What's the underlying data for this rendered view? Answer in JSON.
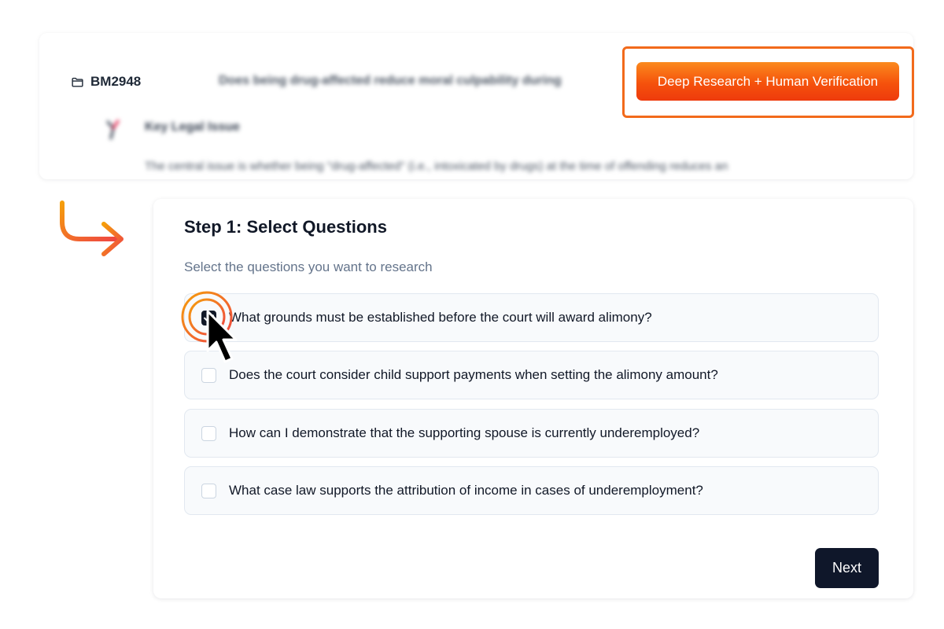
{
  "case": {
    "id": "BM2948",
    "question": "Does being drug-affected reduce moral culpability during",
    "issue_title": "Key Legal Issue",
    "issue_text": "The central issue is whether being \"drug-affected\" (i.e., intoxicated by drugs) at the time of offending reduces an"
  },
  "deep_research_button": "Deep Research + Human Verification",
  "step": {
    "title": "Step 1: Select Questions",
    "subtitle": "Select the questions you want to research",
    "questions": [
      {
        "label": "What grounds must be established before the court will award alimony?",
        "checked": true
      },
      {
        "label": "Does the court consider child support payments when setting the alimony amount?",
        "checked": false
      },
      {
        "label": "How can I demonstrate that the supporting spouse is currently underemployed?",
        "checked": false
      },
      {
        "label": "What case law supports the attribution of income in cases of underemployment?",
        "checked": false
      }
    ],
    "next_label": "Next"
  },
  "icons": [
    "folder-icon",
    "issue-icon",
    "curved-arrow-icon",
    "click-indicator-icon",
    "mouse-cursor-icon"
  ],
  "colors": {
    "accent_orange": "#f26a1b",
    "button_gradient_start": "#fb8a1e",
    "button_gradient_end": "#ee3a0c",
    "primary_dark": "#0f172a",
    "muted_text": "#64748b"
  }
}
